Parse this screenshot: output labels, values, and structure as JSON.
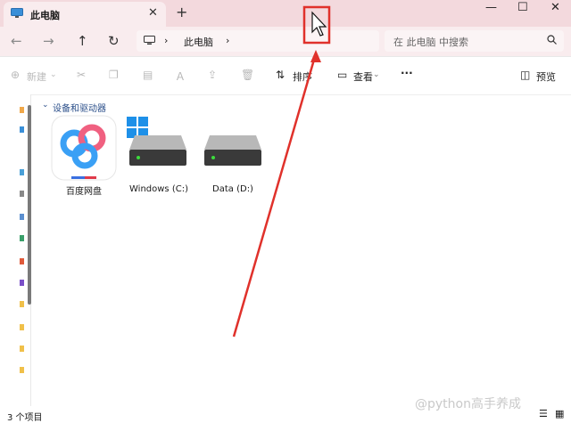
{
  "window": {
    "tab_title": "此电脑",
    "new_tab_label": "+",
    "controls": {
      "minimize": "—",
      "maximize": "☐",
      "close": "✕"
    }
  },
  "navigation": {
    "back": "←",
    "forward": "→",
    "up": "↑",
    "refresh": "↻",
    "breadcrumb": [
      "此电脑"
    ],
    "search_placeholder": "在 此电脑 中搜索"
  },
  "toolbar": {
    "new_label": "新建",
    "sort_label": "排序",
    "view_label": "查看",
    "more_label": "···",
    "preview_label": "预览"
  },
  "content": {
    "group_title": "设备和驱动器",
    "items": [
      {
        "name": "百度网盘",
        "icon": "baidu-netdisk-icon"
      },
      {
        "name": "Windows (C:)",
        "icon": "system-drive-icon"
      },
      {
        "name": "Data (D:)",
        "icon": "hard-drive-icon"
      }
    ]
  },
  "status": {
    "item_count": "3 个项目"
  },
  "watermark": "@python高手养成",
  "colors": {
    "titlebar": "#f3d9dd",
    "nav": "#f9ecee",
    "accent_red": "#e0312b",
    "baidu_blue": "#3aa0f5"
  }
}
